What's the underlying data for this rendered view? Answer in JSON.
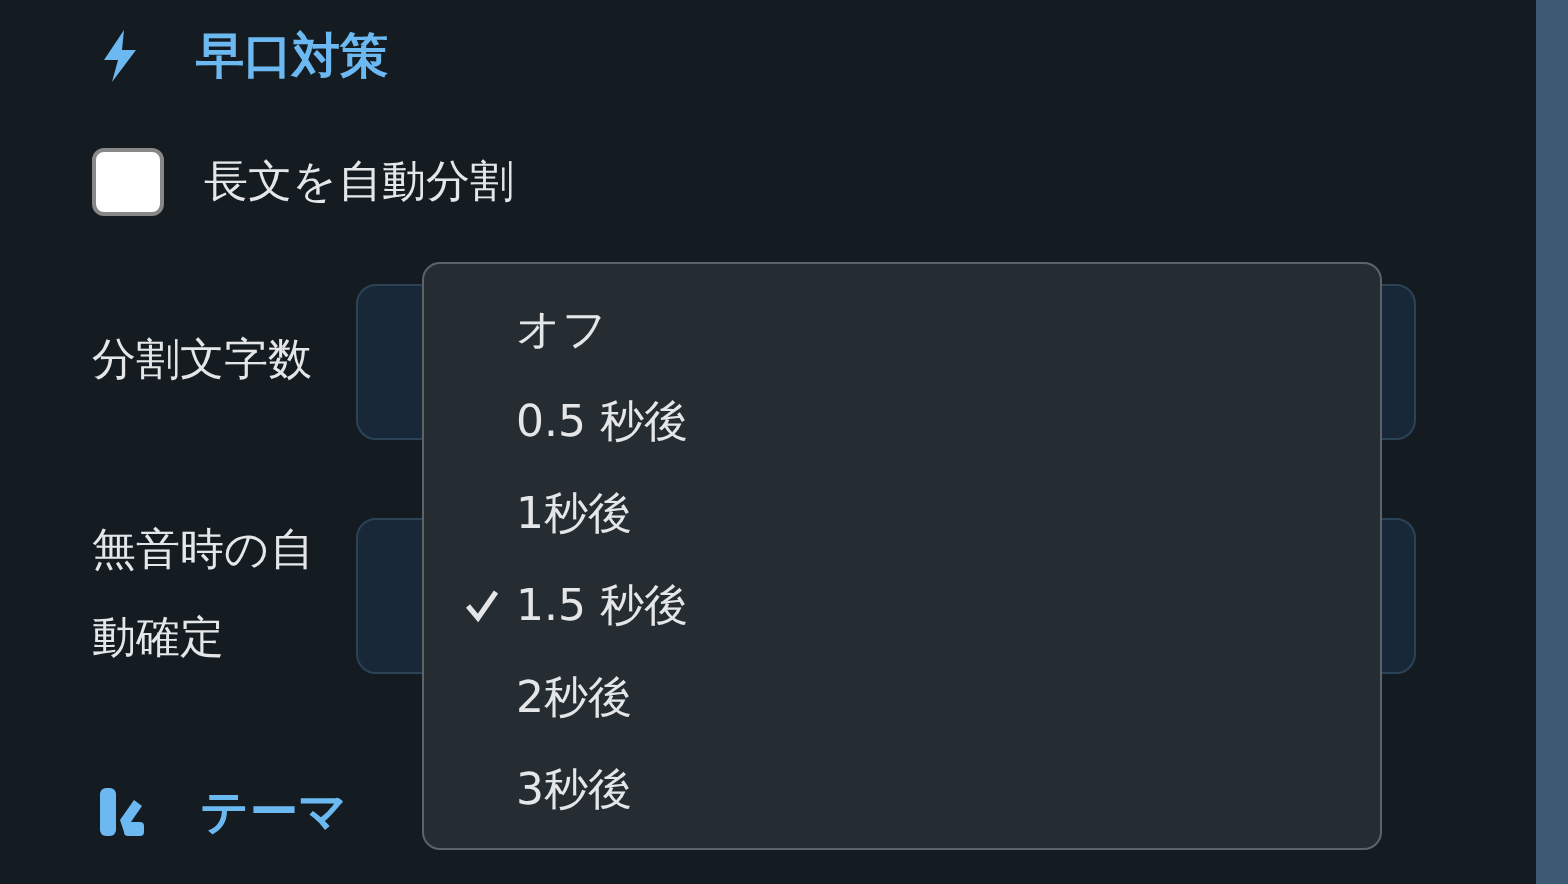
{
  "speech_section": {
    "title": "早口対策",
    "checkbox": {
      "label": "長文を自動分割",
      "checked": false
    },
    "selects": [
      {
        "label": "分割文字数"
      },
      {
        "label": "無音時の自動確定"
      }
    ]
  },
  "dropdown": {
    "options": [
      {
        "label": "オフ",
        "selected": false
      },
      {
        "label": "0.5 秒後",
        "selected": false
      },
      {
        "label": "1秒後",
        "selected": false
      },
      {
        "label": "1.5 秒後",
        "selected": true
      },
      {
        "label": "2秒後",
        "selected": false
      },
      {
        "label": "3秒後",
        "selected": false
      }
    ]
  },
  "theme_section": {
    "title": "テーマ"
  }
}
